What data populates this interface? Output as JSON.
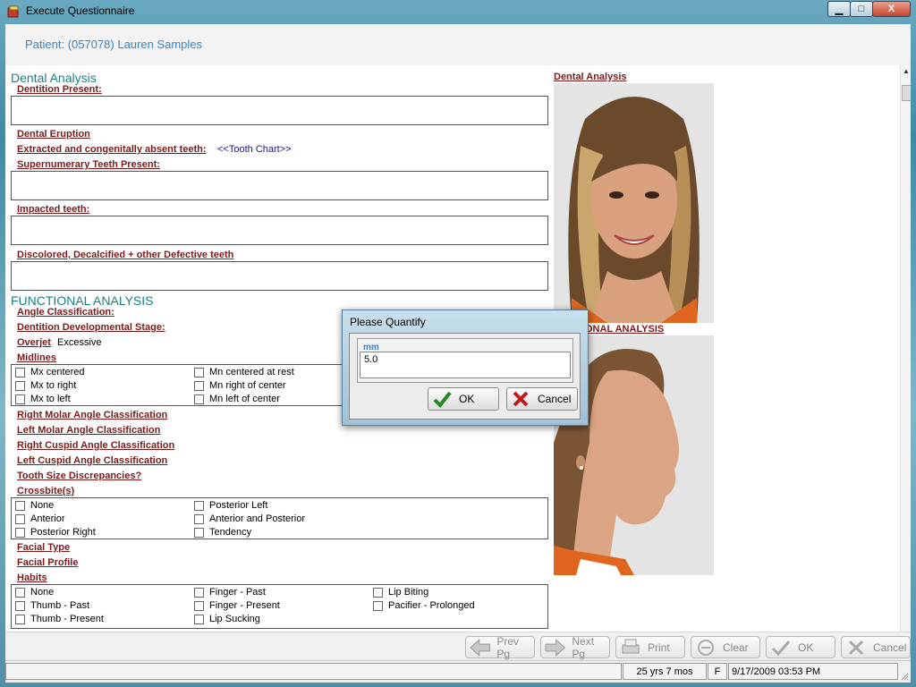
{
  "window": {
    "title": "Execute Questionnaire",
    "min_glyph": "▁",
    "max_glyph": "□",
    "close_glyph": "X"
  },
  "patient": {
    "label": "Patient: (057078) Lauren Samples"
  },
  "dental": {
    "section_title": "Dental Analysis",
    "dentition_present": "Dentition Present:",
    "dental_eruption": "Dental Eruption",
    "extracted": "Extracted and congenitally absent teeth:",
    "tooth_chart": "<<Tooth Chart>>",
    "supernumerary": "Supernumerary Teeth Present:",
    "impacted": "Impacted teeth:",
    "discolored": "Discolored, Decalcified + other Defective teeth"
  },
  "functional": {
    "section_title": "FUNCTIONAL ANALYSIS",
    "angle_classification": "Angle Classification:",
    "dentition_stage": "Dentition Developmental Stage:",
    "overjet_label": "Overjet",
    "overjet_value": "Excessive",
    "midlines": "Midlines",
    "midline_options": [
      "Mx centered",
      "Mx to right",
      "Mx to left",
      "Mn centered at rest",
      "Mn right of center",
      "Mn left of center"
    ],
    "right_molar": "Right Molar Angle Classification",
    "left_molar": "Left Molar Angle Classification",
    "right_cuspid": "Right Cuspid Angle Classification",
    "left_cuspid": "Left Cuspid Angle Classification",
    "tooth_size": "Tooth Size Discrepancies?",
    "crossbites": "Crossbite(s)",
    "crossbite_options": [
      "None",
      "Anterior",
      "Posterior Right",
      "Posterior Left",
      "Anterior and Posterior",
      "Tendency"
    ],
    "facial_type": "Facial Type",
    "facial_profile": "Facial Profile",
    "habits": "Habits",
    "habit_options": [
      "None",
      "Thumb - Past",
      "Thumb - Present",
      "Finger - Past",
      "Finger - Present",
      "Lip Sucking",
      "Lip Biting",
      "Pacifier - Prolonged"
    ]
  },
  "right_panel": {
    "photo1_heading": "Dental Analysis",
    "photo2_heading": "ONAL ANALYSIS"
  },
  "dialog": {
    "title": "Please Quantify",
    "unit_label": "mm",
    "value": "5.0",
    "ok_label": "OK",
    "cancel_label": "Cancel"
  },
  "toolbar": {
    "prev": "Prev Pg",
    "next": "Next Pg",
    "print": "Print",
    "clear": "Clear",
    "ok": "OK",
    "cancel": "Cancel"
  },
  "status": {
    "age": "25 yrs 7 mos",
    "sex": "F",
    "datetime": "9/17/2009 03:53 PM"
  },
  "colors": {
    "section_title": "#1a7f7f",
    "field_label": "#7b1a1a",
    "patient_text": "#3a84c4"
  }
}
